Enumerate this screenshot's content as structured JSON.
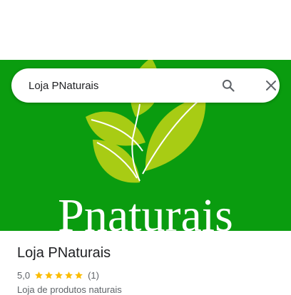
{
  "search": {
    "value": "Loja PNaturais"
  },
  "hero": {
    "brand_text": "Pnaturais",
    "background_color": "#0a9c0f",
    "leaf_color": "#a8cc14"
  },
  "place": {
    "title": "Loja PNaturais",
    "rating": "5,0",
    "stars": 5,
    "review_count": "(1)",
    "category": "Loja de produtos naturais"
  },
  "colors": {
    "star": "#fbbc04",
    "text_primary": "#202124",
    "text_secondary": "#5f6368"
  },
  "icons": {
    "search": "search-icon",
    "clear": "close-icon",
    "star": "star-icon"
  }
}
